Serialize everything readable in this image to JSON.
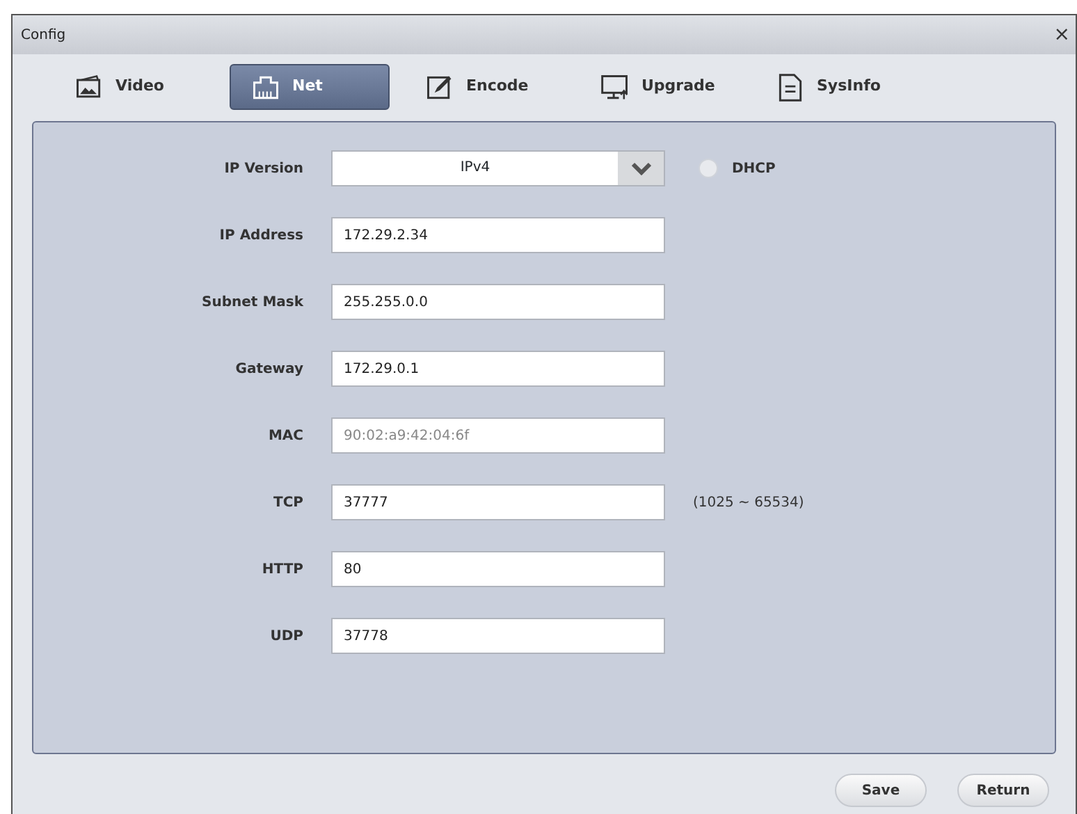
{
  "window": {
    "title": "Config",
    "close": "×"
  },
  "tabs": [
    {
      "label": "Video",
      "kind": "picture",
      "selected": false
    },
    {
      "label": "Net",
      "kind": "network",
      "selected": true
    },
    {
      "label": "Encode",
      "kind": "edit",
      "selected": false
    },
    {
      "label": "Upgrade",
      "kind": "monitor",
      "selected": false
    },
    {
      "label": "SysInfo",
      "kind": "document",
      "selected": false
    }
  ],
  "fields": [
    {
      "kind": "select",
      "label": "IP Version",
      "value": "IPv4",
      "option": {
        "label": "DHCP",
        "checked": false
      }
    },
    {
      "kind": "text",
      "label": "IP Address",
      "value": "172.29.2.34",
      "disabled": false
    },
    {
      "kind": "text",
      "label": "Subnet Mask",
      "value": "255.255.0.0",
      "disabled": false
    },
    {
      "kind": "text",
      "label": "Gateway",
      "value": "172.29.0.1",
      "disabled": false
    },
    {
      "kind": "text",
      "label": "MAC",
      "value": "90:02:a9:42:04:6f",
      "disabled": true
    },
    {
      "kind": "text",
      "label": "TCP",
      "value": "37777",
      "disabled": false,
      "hint": "(1025 ~ 65534)"
    },
    {
      "kind": "text",
      "label": "HTTP",
      "value": "80",
      "disabled": false
    },
    {
      "kind": "text",
      "label": "UDP",
      "value": "37778",
      "disabled": false
    }
  ],
  "buttons": [
    "Save",
    "Return"
  ]
}
